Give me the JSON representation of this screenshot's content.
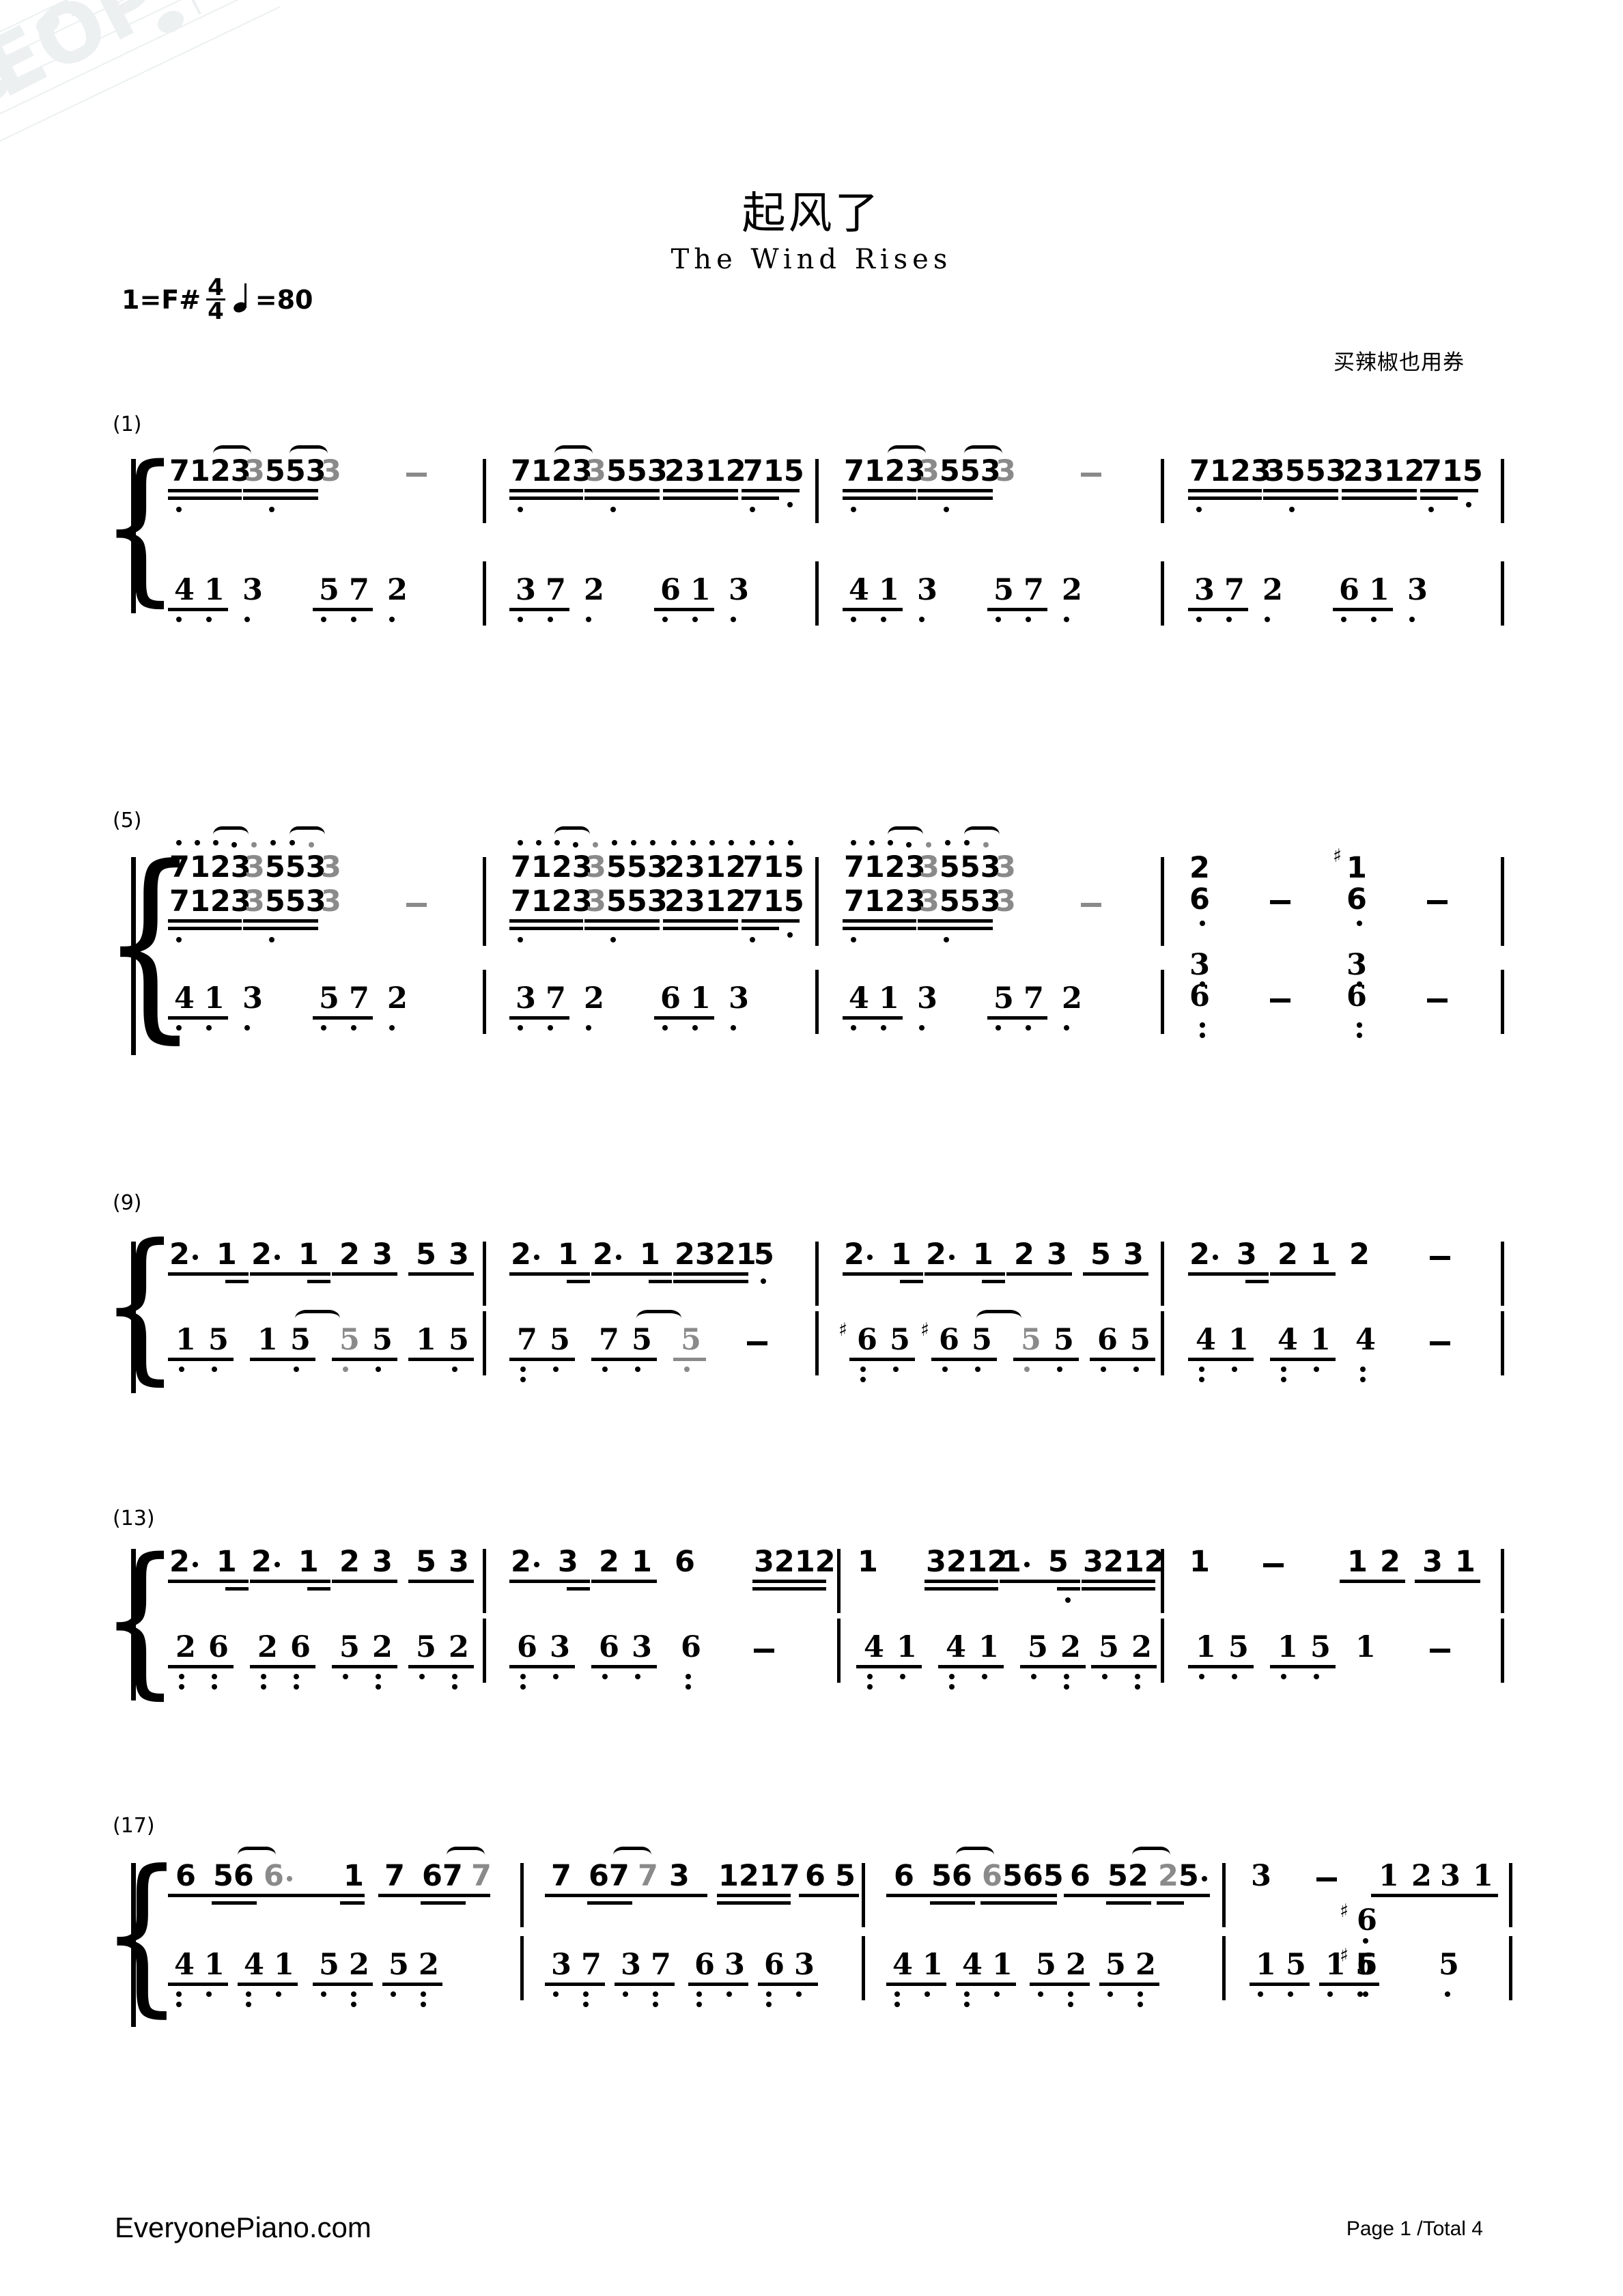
{
  "meta": {
    "notation": "jianpu-numbered-notation",
    "colors": {
      "ink": "#000000",
      "secondary_voice": "#8a8a8a",
      "watermark": "#dde5e7"
    }
  },
  "header": {
    "title_cn": "起风了",
    "title_en": "The Wind Rises",
    "key_label": "1=F#",
    "time_sig_num": "4",
    "time_sig_den": "4",
    "tempo_eq": "=80",
    "artist": "买辣椒也用券"
  },
  "watermark": {
    "label": "EOP"
  },
  "footer": {
    "site": "EveryonePiano.com",
    "page": "Page 1 /Total 4"
  },
  "systems": [
    {
      "number": "(1)",
      "measures": [
        "1",
        "2",
        "3",
        "4"
      ],
      "treble": [
        {
          "measure": 1,
          "groups": [
            "7123",
            "3553",
            "3"
          ],
          "rest_dash": true
        },
        {
          "measure": 2,
          "groups": [
            "7123",
            "3553",
            "2312",
            "715"
          ]
        },
        {
          "measure": 3,
          "groups": [
            "7123",
            "3553",
            "3"
          ],
          "rest_dash": true
        },
        {
          "measure": 4,
          "groups": [
            "7123",
            "3553",
            "2312",
            "715"
          ]
        }
      ],
      "bass": [
        {
          "measure": 1,
          "notes": "4 1 3 5 7 2"
        },
        {
          "measure": 2,
          "notes": "3 7 2 6 1 3"
        },
        {
          "measure": 3,
          "notes": "4 1 3 5 7 2"
        },
        {
          "measure": 4,
          "notes": "3 7 2 6 1 3"
        }
      ]
    },
    {
      "number": "(5)",
      "measures": [
        "5",
        "6",
        "7",
        "8"
      ],
      "treble_upper": [
        {
          "measure": 5,
          "groups": [
            "7123",
            "3553",
            "3"
          ]
        },
        {
          "measure": 6,
          "groups": [
            "7123",
            "3553",
            "2312",
            "715"
          ]
        },
        {
          "measure": 7,
          "groups": [
            "7123",
            "3553",
            "3"
          ]
        },
        {
          "measure": 8,
          "chords": [
            {
              "notes": [
                "2",
                "6"
              ]
            },
            {
              "notes": [
                "#1",
                "6"
              ]
            }
          ]
        }
      ],
      "treble_lower": [
        {
          "measure": 5,
          "groups": [
            "7123",
            "3553",
            "3"
          ],
          "rest_dash": true
        },
        {
          "measure": 6,
          "groups": [
            "7123",
            "3553",
            "2312",
            "715"
          ]
        },
        {
          "measure": 7,
          "groups": [
            "7123",
            "3553",
            "3"
          ],
          "rest_dash": true
        }
      ],
      "bass": [
        {
          "measure": 5,
          "notes": "4 1 3 5 7 2"
        },
        {
          "measure": 6,
          "notes": "3 7 2 6 1 3"
        },
        {
          "measure": 7,
          "notes": "4 1 3 5 7 2"
        },
        {
          "measure": 8,
          "chords": [
            {
              "notes": [
                "3",
                "6"
              ]
            },
            {
              "notes": [
                "3",
                "6"
              ]
            }
          ]
        }
      ]
    },
    {
      "number": "(9)",
      "measures": [
        "9",
        "10",
        "11",
        "12"
      ],
      "treble": [
        {
          "measure": 9,
          "groups": [
            "2·",
            "1",
            "2·",
            "1",
            "2 3",
            "5 3"
          ]
        },
        {
          "measure": 10,
          "groups": [
            "2·",
            "1",
            "2·",
            "1",
            "2321",
            "5"
          ]
        },
        {
          "measure": 11,
          "groups": [
            "2·",
            "1",
            "2·",
            "1",
            "2 3",
            "5 3"
          ]
        },
        {
          "measure": 12,
          "groups": [
            "2·",
            "3",
            "2 1",
            "2"
          ],
          "rest_dash": true
        }
      ],
      "bass": [
        {
          "measure": 9,
          "notes": "1 5 1 5 5 5 1 5"
        },
        {
          "measure": 10,
          "notes": "7 5 7 5 5"
        },
        {
          "measure": 11,
          "notes": "#6 5 #6 5 5 5 6 5"
        },
        {
          "measure": 12,
          "notes": "4 1 4 1 4"
        }
      ]
    },
    {
      "number": "(13)",
      "measures": [
        "13",
        "14",
        "15",
        "16"
      ],
      "treble": [
        {
          "measure": 13,
          "groups": [
            "2·",
            "1",
            "2·",
            "1",
            "2 3",
            "5 3"
          ]
        },
        {
          "measure": 14,
          "groups": [
            "2·",
            "3",
            "2 1",
            "6",
            "3212"
          ]
        },
        {
          "measure": 15,
          "groups": [
            "1",
            "3212",
            "1·",
            "5",
            "3212"
          ]
        },
        {
          "measure": 16,
          "groups": [
            "1",
            "1 2",
            "3 1"
          ],
          "rest_dash": true
        }
      ],
      "bass": [
        {
          "measure": 13,
          "notes": "2 6 2 6 5 2 5 2"
        },
        {
          "measure": 14,
          "notes": "6 3 6 3 6"
        },
        {
          "measure": 15,
          "notes": "4 1 4 1 5 2 5 2"
        },
        {
          "measure": 16,
          "notes": "1 5 1 5 1"
        }
      ]
    },
    {
      "number": "(17)",
      "measures": [
        "17",
        "18",
        "19",
        "20"
      ],
      "treble": [
        {
          "measure": 17,
          "groups": [
            "6",
            "56",
            "6·",
            "1 7",
            "67",
            "7"
          ]
        },
        {
          "measure": 18,
          "groups": [
            "7",
            "67",
            "7 3",
            "1217",
            "6 5"
          ]
        },
        {
          "measure": 19,
          "groups": [
            "6",
            "56",
            "6565",
            "6",
            "52",
            "25·"
          ]
        },
        {
          "measure": 20,
          "groups": [
            "3",
            "1 2",
            "3 1"
          ],
          "rest_dash": true
        }
      ],
      "bass": [
        {
          "measure": 17,
          "notes": "4 1 4 1 5 2 5 2"
        },
        {
          "measure": 18,
          "notes": "3 7 3 7 6 3 6 3"
        },
        {
          "measure": 19,
          "notes": "4 1 4 1 5 2 5 2"
        },
        {
          "measure": 20,
          "notes": "1 5 1 5 #6 #6 5"
        }
      ]
    }
  ]
}
